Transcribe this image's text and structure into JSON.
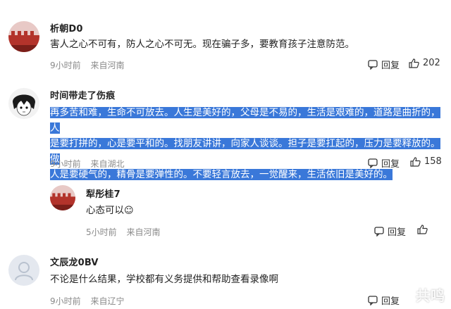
{
  "comments": [
    {
      "username": "析朝D0",
      "text": "害人之心不可有，防人之心不可无。现在骗子多，要教育孩子注意防范。",
      "time": "9小时前",
      "location": "来自河南",
      "reply_label": "回复",
      "likes": "202",
      "avatar": "red-wall-avatar"
    },
    {
      "username": "时间带走了伤痕",
      "text_lines": [
        "再多苦和难，生命不可放去。人生是美好的，父母是不易的，生活是艰难的，道路是曲折的，人",
        "是要打拼的，心是要平和的。找朋友讲讲，向家人谈谈。担子是要扛起的，压力是要释放的。做",
        "人是要硬气的，精骨是要弹性的。不要轻言放去，一觉醒来，生活依旧是美好的。"
      ],
      "time": "9小时前",
      "location": "来自湖北",
      "reply_label": "回复",
      "likes": "158",
      "avatar": "anime-sketch-avatar",
      "highlight_color": "#3a78d9"
    },
    {
      "username": "犁彤桂7",
      "text": "心态可以",
      "emoji": "☺",
      "time": "5小时前",
      "location": "来自河南",
      "reply_label": "回复",
      "avatar": "red-wall-avatar"
    },
    {
      "username": "文辰龙0BV",
      "text": "不论是什么结果，学校都有义务提供和帮助查看录像啊",
      "time": "9小时前",
      "location": "来自辽宁",
      "reply_label": "回复",
      "avatar": "default-user-avatar"
    }
  ],
  "watermark": "共鸣"
}
